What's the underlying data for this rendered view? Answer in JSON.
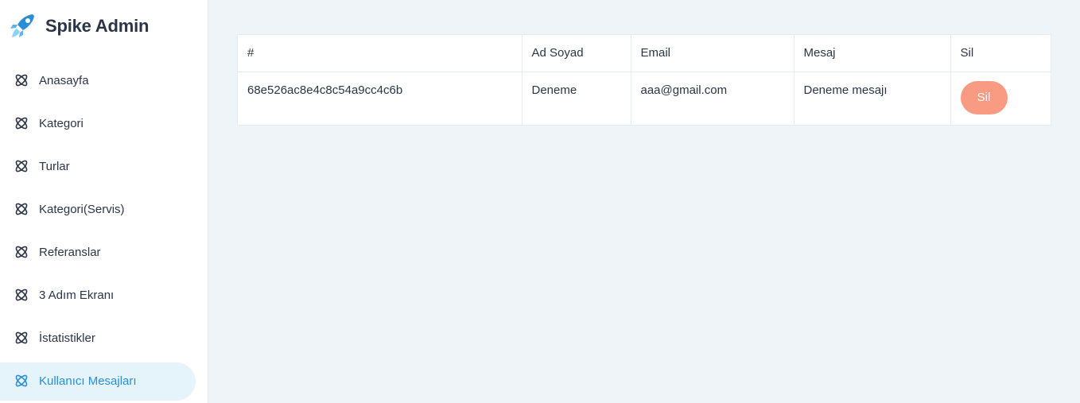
{
  "brand": {
    "name": "Spike Admin"
  },
  "sidebar": {
    "items": [
      {
        "label": "Anasayfa",
        "active": false
      },
      {
        "label": "Kategori",
        "active": false
      },
      {
        "label": "Turlar",
        "active": false
      },
      {
        "label": "Kategori(Servis)",
        "active": false
      },
      {
        "label": "Referanslar",
        "active": false
      },
      {
        "label": "3 Adım Ekranı",
        "active": false
      },
      {
        "label": "İstatistikler",
        "active": false
      },
      {
        "label": "Kullanıcı Mesajları",
        "active": true
      }
    ]
  },
  "table": {
    "headers": [
      "#",
      "Ad Soyad",
      "Email",
      "Mesaj",
      "Sil"
    ],
    "rows": [
      {
        "id": "68e526ac8e4c8c54a9cc4c6b",
        "name": "Deneme",
        "email": "aaa@gmail.com",
        "message": "Deneme mesajı",
        "delete_label": "Sil"
      }
    ]
  },
  "colors": {
    "accent": "#2a8ed6",
    "active_bg": "#e5f3fb",
    "delete_button": "#f89b82",
    "page_bg": "#eff4f8"
  },
  "icons": {
    "nav_item": "atom-icon",
    "brand": "rocket-icon"
  }
}
